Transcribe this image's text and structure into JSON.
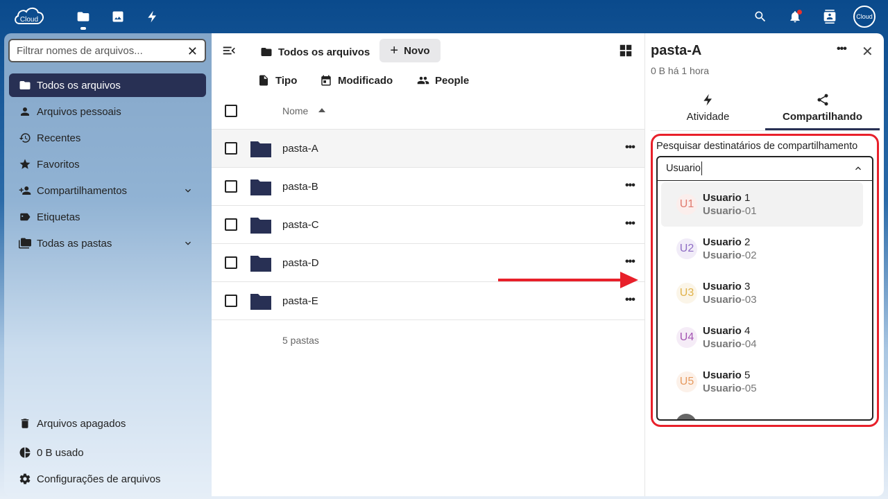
{
  "header": {
    "logo_text": "Cloud",
    "avatar_text": "Cloud",
    "apps": [
      "files-icon",
      "photos-icon",
      "activity-icon"
    ],
    "right_icons": [
      "search-icon",
      "notifications-icon",
      "contacts-icon"
    ]
  },
  "sidebar": {
    "filter_placeholder": "Filtrar nomes de arquivos...",
    "items": [
      {
        "label": "Todos os arquivos",
        "icon": "folder-icon",
        "active": true
      },
      {
        "label": "Arquivos pessoais",
        "icon": "person-icon"
      },
      {
        "label": "Recentes",
        "icon": "history-icon"
      },
      {
        "label": "Favoritos",
        "icon": "star-icon"
      },
      {
        "label": "Compartilhamentos",
        "icon": "share-person-icon",
        "expandable": true
      },
      {
        "label": "Etiquetas",
        "icon": "tag-icon"
      },
      {
        "label": "Todas as pastas",
        "icon": "folders-icon",
        "expandable": true
      }
    ],
    "footer": [
      {
        "label": "Arquivos apagados",
        "icon": "trash-icon"
      },
      {
        "label": "0 B usado",
        "icon": "pie-icon"
      },
      {
        "label": "Configurações de arquivos",
        "icon": "gear-icon"
      }
    ]
  },
  "main": {
    "breadcrumb": "Todos os arquivos",
    "new_button": "Novo",
    "filters": [
      "Tipo",
      "Modificado",
      "People"
    ],
    "column_name": "Nome",
    "rows": [
      "pasta-A",
      "pasta-B",
      "pasta-C",
      "pasta-D",
      "pasta-E"
    ],
    "count_label": "5 pastas"
  },
  "panel": {
    "title": "pasta-A",
    "subtitle": "0 B há 1 hora",
    "tabs": [
      "Atividade",
      "Compartilhando"
    ],
    "share_label": "Pesquisar destinatários de compartilhamento",
    "share_value": "Usuario",
    "options": [
      {
        "initials": "U1",
        "match": "Usuario",
        "rest": " 1",
        "id_match": "Usuario",
        "id_rest": "-01",
        "color": "#e07a6e",
        "bg": "#fbeeec"
      },
      {
        "initials": "U2",
        "match": "Usuario",
        "rest": " 2",
        "id_match": "Usuario",
        "id_rest": "-02",
        "color": "#8e6cc4",
        "bg": "#f1ecf8"
      },
      {
        "initials": "U3",
        "match": "Usuario",
        "rest": " 3",
        "id_match": "Usuario",
        "id_rest": "-03",
        "color": "#e0b24a",
        "bg": "#fbf5e8"
      },
      {
        "initials": "U4",
        "match": "Usuario",
        "rest": " 4",
        "id_match": "Usuario",
        "id_rest": "-04",
        "color": "#a455b3",
        "bg": "#f5ecf7"
      },
      {
        "initials": "U5",
        "match": "Usuario",
        "rest": " 5",
        "id_match": "Usuario",
        "id_rest": "-05",
        "color": "#e69a5f",
        "bg": "#fcf1e9"
      }
    ]
  },
  "colors": {
    "accent": "#283054",
    "highlight": "#e8202a"
  }
}
